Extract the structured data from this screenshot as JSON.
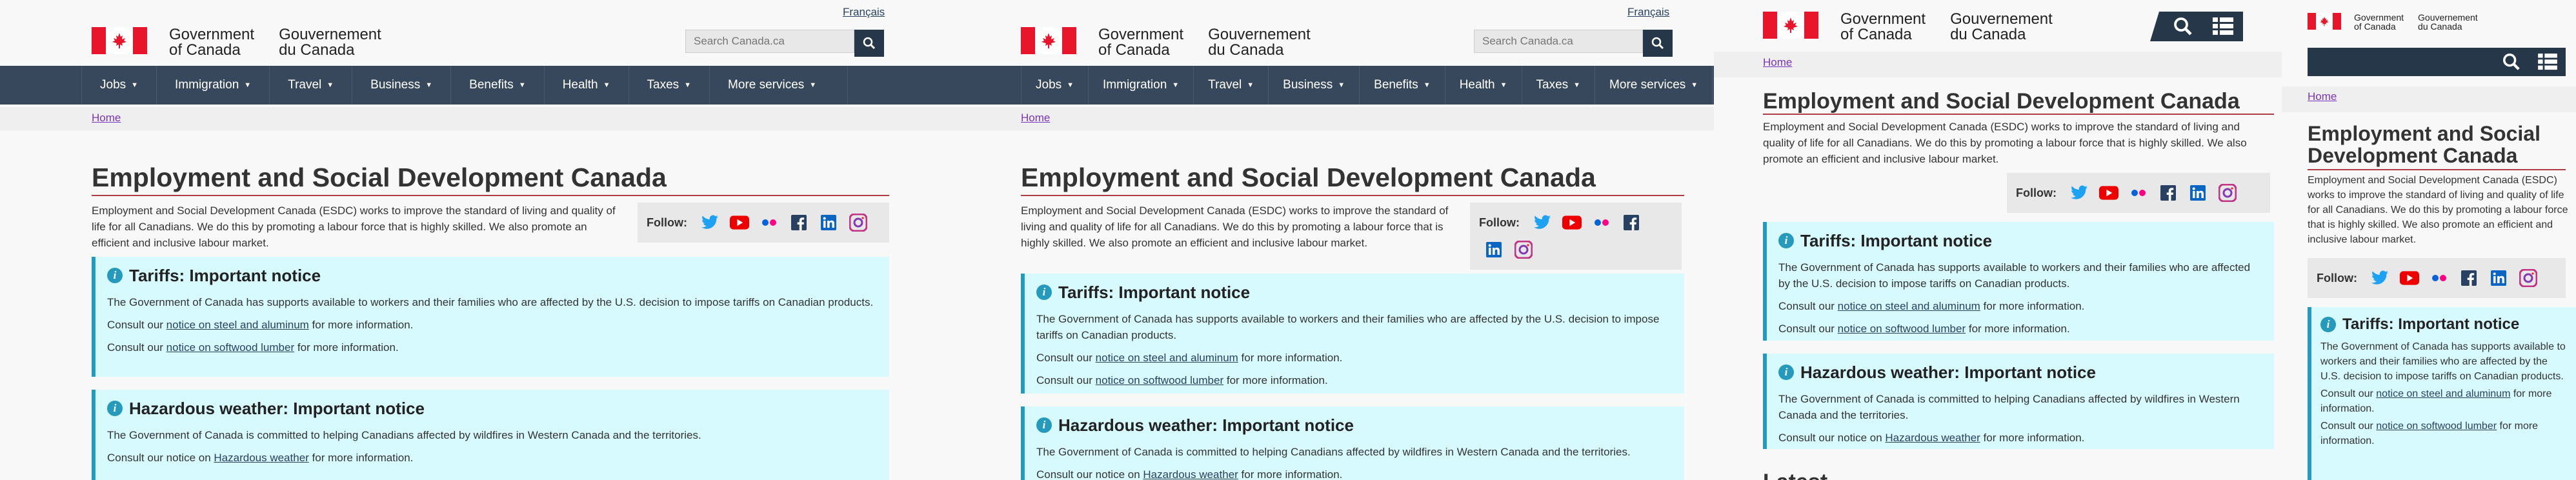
{
  "header": {
    "lang_toggle": "Français",
    "wordmark_en": [
      "Government",
      "of Canada"
    ],
    "wordmark_fr": [
      "Gouvernement",
      "du Canada"
    ],
    "search_placeholder": "Search Canada.ca"
  },
  "menu": [
    "Jobs",
    "Immigration",
    "Travel",
    "Business",
    "Benefits",
    "Health",
    "Taxes",
    "More services"
  ],
  "breadcrumb": "Home",
  "page": {
    "title": "Employment and Social Development Canada",
    "intro": "Employment and Social Development Canada (ESDC) works to improve the standard of living and quality of life for all Canadians. We do this by promoting a labour force that is highly skilled. We also promote an efficient and inclusive labour market.",
    "follow_label": "Follow:",
    "social_icons": [
      "twitter-icon",
      "youtube-icon",
      "flickr-icon",
      "facebook-icon",
      "linkedin-icon",
      "instagram-icon"
    ]
  },
  "notices": {
    "tariffs": {
      "title": "Tariffs: Important notice",
      "body": "The Government of Canada has supports available to workers and their families who are affected by the U.S. decision to impose tariffs on Canadian products.",
      "line1_pre": "Consult our ",
      "line1_link": "notice on steel and aluminum",
      "line1_post": " for more information.",
      "line2_pre": "Consult our ",
      "line2_link": "notice on softwood lumber",
      "line2_post": " for more information."
    },
    "hazardous": {
      "title": "Hazardous weather: Important notice",
      "body": "The Government of Canada is committed to helping Canadians affected by wildfires in Western Canada and the territories.",
      "line_pre": "Consult our notice on ",
      "line_link": "Hazardous weather",
      "line_post": " for more information."
    }
  },
  "partial_heading": "Latest",
  "colors": {
    "header_bar": "#38485c",
    "dark_bar": "#26374a",
    "rule": "#af3c43",
    "notice_bg": "#d7faff",
    "notice_border": "#269abc",
    "flag_red": "#e8152b",
    "link": "#284162",
    "visited": "#7834bc"
  }
}
